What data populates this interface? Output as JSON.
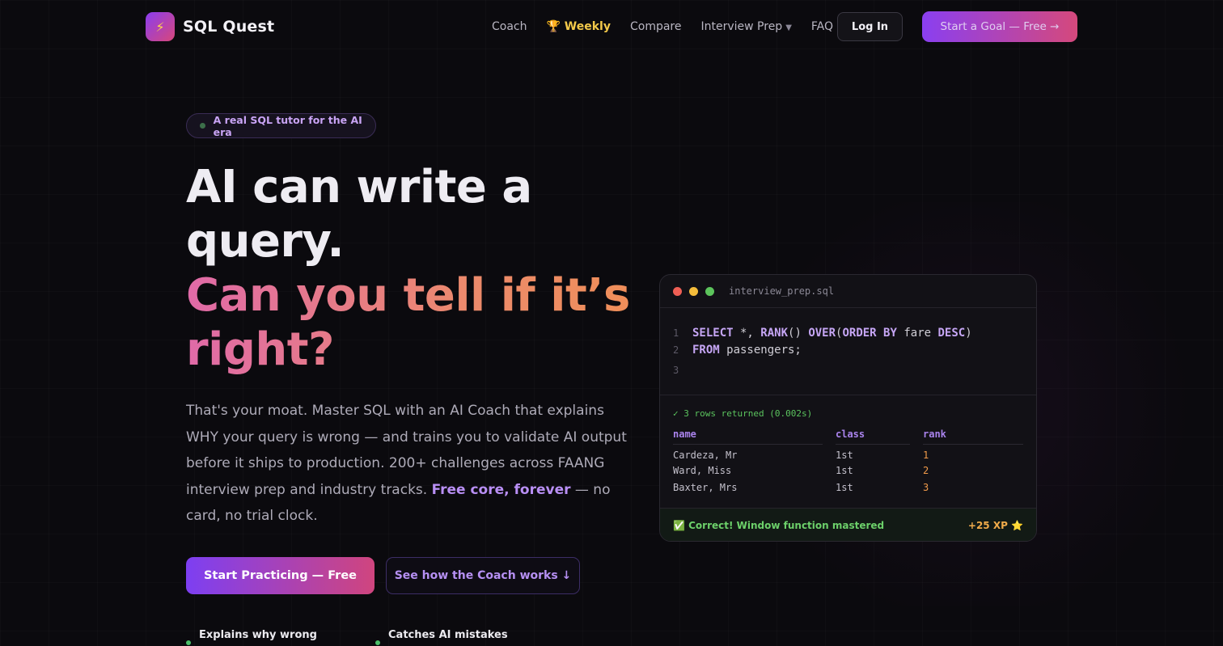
{
  "nav": {
    "logo_icon": "⚡",
    "logo_text": "SQL Quest",
    "links": [
      {
        "label": "Coach"
      },
      {
        "label": "🏆 Weekly"
      },
      {
        "label": "Compare"
      },
      {
        "label": "Interview Prep",
        "caret": "▼"
      },
      {
        "label": "FAQ"
      }
    ],
    "login_label": "Log In",
    "goal_label": "Start a Goal — Free →"
  },
  "hero": {
    "badge": "A real SQL tutor for the AI era",
    "headline_line1": "AI can write a",
    "headline_line2": "query.",
    "headline_line3": "Can you tell if it’s",
    "headline_line4": "right?",
    "para_part1": "That's your moat. Master SQL with an AI Coach that explains WHY your query is wrong — and trains you to validate AI output before it ships to production. 200+ challenges across FAANG interview prep and industry tracks. ",
    "para_highlight": "Free core, forever",
    "para_part2": " — no card, no trial clock.",
    "start_label": "Start Practicing — Free",
    "see_label": "See how the Coach works ↓",
    "features": [
      "Explains why wrong",
      "Catches AI mistakes"
    ]
  },
  "code_card": {
    "file_name": "interview_prep.sql",
    "line_numbers": [
      "1",
      "2",
      "3"
    ],
    "code": {
      "l1_k1": "SELECT",
      "l1_t1": " *, ",
      "l1_k2": "RANK",
      "l1_t2": "() ",
      "l1_k3": "OVER",
      "l1_t3": "(",
      "l1_k4": "ORDER BY",
      "l1_t4": " fare ",
      "l1_k5": "DESC",
      "l1_t5": ")",
      "l2_k1": "FROM",
      "l2_t1": " passengers;"
    },
    "result_status": "✓ 3 rows returned (0.002s)",
    "columns": [
      "name",
      "class",
      "rank"
    ],
    "rows": [
      [
        "Cardeza, Mr",
        "1st",
        "1"
      ],
      [
        "Ward, Miss",
        "1st",
        "2"
      ],
      [
        "Baxter, Mrs",
        "1st",
        "3"
      ]
    ],
    "footer_left": "✅ Correct! Window function mastered",
    "footer_right": "+25 XP ⭐"
  },
  "colors": {
    "accent_purple": "#8a3ff0",
    "accent_pink": "#d5497c",
    "success_green": "#5bc45e",
    "rank_orange": "#f09a4a"
  }
}
